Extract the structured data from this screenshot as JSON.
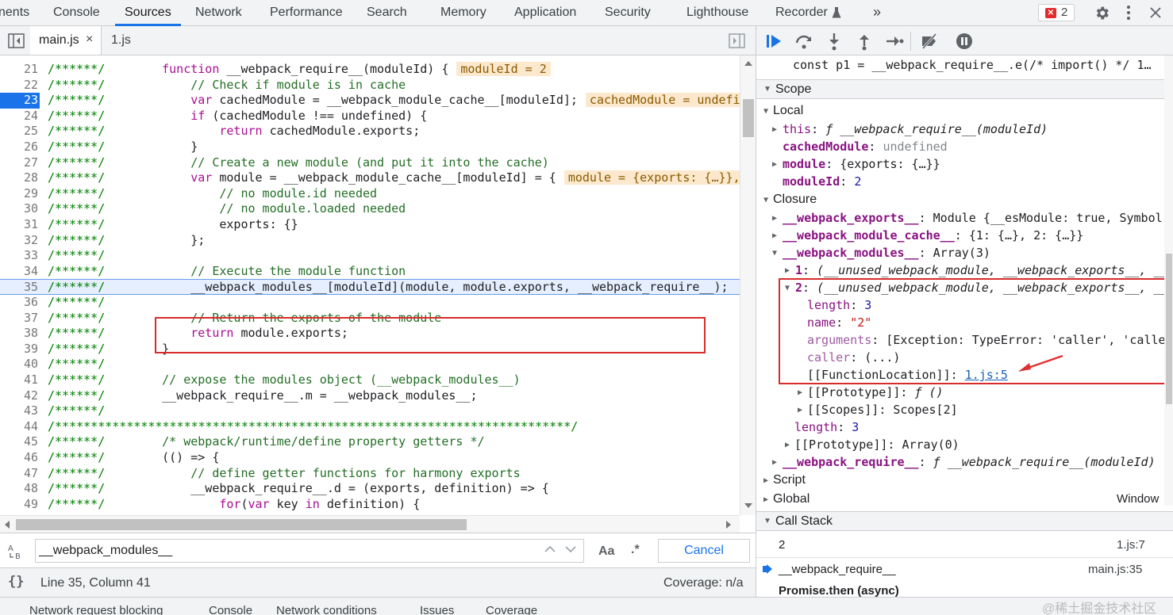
{
  "top_tabs": [
    "nents",
    "Console",
    "Sources",
    "Network",
    "Performance",
    "Search",
    "Memory",
    "Application",
    "Security",
    "Lighthouse",
    "Recorder"
  ],
  "active_top_tab": "Sources",
  "error_count": "2",
  "more_tabs": "»",
  "editor_tabs": [
    {
      "label": "main.js",
      "close": "×"
    },
    {
      "label": "1.js"
    }
  ],
  "code_lines": [
    {
      "n": "21",
      "g": "/******/",
      "t": "    function __webpack_require__(moduleId) {",
      "v": "moduleId = 2"
    },
    {
      "n": "22",
      "g": "/******/",
      "t": "        // Check if module is in cache"
    },
    {
      "n": "23",
      "g": "/******/",
      "t": "        var cachedModule = __webpack_module_cache__[moduleId];",
      "v": "cachedModule = undefined,"
    },
    {
      "n": "24",
      "g": "/******/",
      "t": "        if (cachedModule !== undefined) {"
    },
    {
      "n": "25",
      "g": "/******/",
      "t": "            return cachedModule.exports;"
    },
    {
      "n": "26",
      "g": "/******/",
      "t": "        }"
    },
    {
      "n": "27",
      "g": "/******/",
      "t": "        // Create a new module (and put it into the cache)"
    },
    {
      "n": "28",
      "g": "/******/",
      "t": "        var module = __webpack_module_cache__[moduleId] = {",
      "v": "module = {exports: {…}}, mod"
    },
    {
      "n": "29",
      "g": "/******/",
      "t": "            // no module.id needed"
    },
    {
      "n": "30",
      "g": "/******/",
      "t": "            // no module.loaded needed"
    },
    {
      "n": "31",
      "g": "/******/",
      "t": "            exports: {}"
    },
    {
      "n": "32",
      "g": "/******/",
      "t": "        };"
    },
    {
      "n": "33",
      "g": "/******/",
      "t": ""
    },
    {
      "n": "34",
      "g": "/******/",
      "t": "        // Execute the module function"
    },
    {
      "n": "35",
      "g": "/******/",
      "t": "        __webpack_modules__[moduleId](module, module.exports, __webpack_require__);"
    },
    {
      "n": "36",
      "g": "/******/",
      "t": ""
    },
    {
      "n": "37",
      "g": "/******/",
      "t": "        // Return the exports of the module"
    },
    {
      "n": "38",
      "g": "/******/",
      "t": "        return module.exports;"
    },
    {
      "n": "39",
      "g": "/******/",
      "t": "    }"
    },
    {
      "n": "40",
      "g": "/******/",
      "t": ""
    },
    {
      "n": "41",
      "g": "/******/",
      "t": "    // expose the modules object (__webpack_modules__)"
    },
    {
      "n": "42",
      "g": "/******/",
      "t": "    __webpack_require__.m = __webpack_modules__;"
    },
    {
      "n": "43",
      "g": "/******/",
      "t": ""
    },
    {
      "n": "44",
      "g": "/************************************************************************/",
      "t": ""
    },
    {
      "n": "45",
      "g": "/******/",
      "t": "    /* webpack/runtime/define property getters */"
    },
    {
      "n": "46",
      "g": "/******/",
      "t": "    (() => {"
    },
    {
      "n": "47",
      "g": "/******/",
      "t": "        // define getter functions for harmony exports"
    },
    {
      "n": "48",
      "g": "/******/",
      "t": "        __webpack_require__.d = (exports, definition) => {"
    },
    {
      "n": "49",
      "g": "/******/",
      "t": "            for(var key in definition) {"
    }
  ],
  "breakpoint_line": "23",
  "search": {
    "value": "__webpack_modules__",
    "match_case": "Aa",
    "regex": ".*",
    "cancel": "Cancel"
  },
  "status": {
    "braces": "{}",
    "position": "Line 35, Column 41",
    "coverage": "Coverage: n/a"
  },
  "drawer_tabs": [
    "Network request blocking",
    "Console",
    "Network conditions",
    "Issues",
    "Coverage"
  ],
  "right": {
    "paused_line": "const p1 = __webpack_require__.e(/* import() */ 1…",
    "scope_title": "Scope",
    "local_title": "Local",
    "local": [
      {
        "key": "this",
        "val": "ƒ __webpack_require__(moduleId)"
      },
      {
        "key": "cachedModule",
        "val": "undefined"
      },
      {
        "key": "module",
        "val": "{exports: {…}}"
      },
      {
        "key": "moduleId",
        "val": "2"
      }
    ],
    "closure_title": "Closure",
    "closure": [
      {
        "key": "__webpack_exports__",
        "val": "Module {__esModule: true, Symbol("
      },
      {
        "key": "__webpack_module_cache__",
        "val": "{1: {…}, 2: {…}}"
      },
      {
        "key": "__webpack_modules__",
        "val": "Array(3)"
      }
    ],
    "mod1": {
      "key": "1",
      "val": "(__unused_webpack_module, __webpack_exports__, __"
    },
    "mod2": {
      "key": "2",
      "val": "(__unused_webpack_module, __webpack_exports__, __"
    },
    "mod2_props": [
      {
        "key": "length",
        "val": "3"
      },
      {
        "key": "name",
        "val": "\"2\""
      },
      {
        "key": "arguments",
        "val": "[Exception: TypeError: 'caller', 'calle"
      },
      {
        "key": "caller",
        "val": "(...)"
      }
    ],
    "fn_location_key": "[[FunctionLocation]]",
    "fn_location_val": "1.js:5",
    "mod2_proto": {
      "key": "[[Prototype]]",
      "val": "ƒ ()"
    },
    "mod2_scopes": {
      "key": "[[Scopes]]",
      "val": "Scopes[2]"
    },
    "arr_length": {
      "key": "length",
      "val": "3"
    },
    "arr_proto": {
      "key": "[[Prototype]]",
      "val": "Array(0)"
    },
    "webpack_require": {
      "key": "__webpack_require__",
      "val": "ƒ __webpack_require__(moduleId)"
    },
    "script_title": "Script",
    "global_title": "Global",
    "global_val": "Window",
    "callstack_title": "Call Stack",
    "frames": [
      {
        "name": "2",
        "loc": "1.js:7"
      },
      {
        "name": "__webpack_require__",
        "loc": "main.js:35"
      },
      {
        "name": "Promise.then (async)",
        "loc": ""
      }
    ]
  },
  "watermark": "@稀土掘金技术社区"
}
